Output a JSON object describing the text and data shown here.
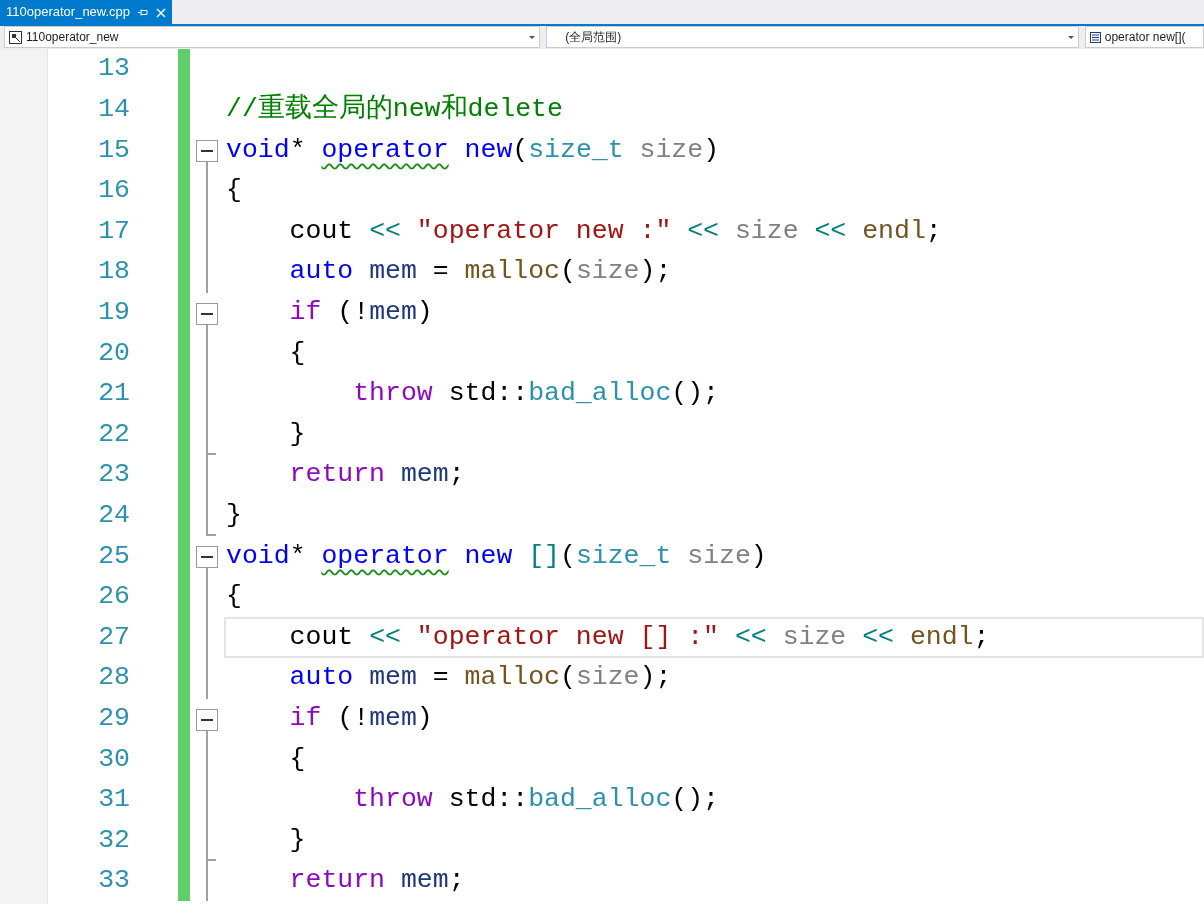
{
  "tabs": [
    {
      "label": "110operator_new.cpp",
      "selected": true,
      "pinned": false
    }
  ],
  "navbar": {
    "project": "110operator_new",
    "scope": "(全局范围)",
    "member": "operator new[]("
  },
  "lines": [
    {
      "number": "13",
      "changed": true,
      "current": false,
      "kind": "plain"
    },
    {
      "number": "14",
      "changed": true,
      "current": false,
      "kind": "plain",
      "tokens": [
        {
          "t": "//重载全局的new和delete",
          "kind": "comment"
        }
      ]
    },
    {
      "number": "15",
      "changed": true,
      "current": false,
      "kind": "fold-start",
      "expanded": true,
      "tokens": [
        {
          "t": "void",
          "kind": "keyword"
        },
        {
          "t": "* ",
          "kind": "plain"
        },
        {
          "t": "operator",
          "kind": "keyword",
          "squiggle": true
        },
        {
          "t": " new",
          "kind": "keyword"
        },
        {
          "t": "(",
          "kind": "plain"
        },
        {
          "t": "size_t",
          "kind": "type"
        },
        {
          "t": " size",
          "kind": "param"
        },
        {
          "t": ")",
          "kind": "plain"
        }
      ]
    },
    {
      "number": "16",
      "changed": true,
      "current": false,
      "kind": "fold-line",
      "tokens": [
        {
          "t": "{",
          "kind": "plain"
        }
      ]
    },
    {
      "number": "17",
      "changed": true,
      "current": false,
      "kind": "fold-line",
      "tokens": [
        {
          "t": "    cout ",
          "kind": "plain"
        },
        {
          "t": "<< ",
          "kind": "op"
        },
        {
          "t": "\"operator new :\"",
          "kind": "string"
        },
        {
          "t": " << ",
          "kind": "op"
        },
        {
          "t": "size",
          "kind": "param"
        },
        {
          "t": " << ",
          "kind": "op"
        },
        {
          "t": "endl",
          "kind": "func"
        },
        {
          "t": ";",
          "kind": "plain"
        }
      ]
    },
    {
      "number": "18",
      "changed": true,
      "current": false,
      "kind": "fold-line",
      "tokens": [
        {
          "t": "    auto",
          "kind": "keyword"
        },
        {
          "t": " mem",
          "kind": "local"
        },
        {
          "t": " = ",
          "kind": "plain"
        },
        {
          "t": "malloc",
          "kind": "func"
        },
        {
          "t": "(",
          "kind": "plain"
        },
        {
          "t": "size",
          "kind": "param"
        },
        {
          "t": ");",
          "kind": "plain"
        }
      ]
    },
    {
      "number": "19",
      "changed": true,
      "current": false,
      "kind": "fold-start",
      "expanded": true,
      "tokens": [
        {
          "t": "    if",
          "kind": "control"
        },
        {
          "t": " (!",
          "kind": "plain"
        },
        {
          "t": "mem",
          "kind": "local"
        },
        {
          "t": ")",
          "kind": "plain"
        }
      ]
    },
    {
      "number": "20",
      "changed": true,
      "current": false,
      "kind": "fold-line",
      "tokens": [
        {
          "t": "    {",
          "kind": "plain"
        }
      ]
    },
    {
      "number": "21",
      "changed": true,
      "current": false,
      "kind": "fold-line",
      "tokens": [
        {
          "t": "        throw",
          "kind": "control"
        },
        {
          "t": " std::",
          "kind": "plain"
        },
        {
          "t": "bad_alloc",
          "kind": "type"
        },
        {
          "t": "();",
          "kind": "plain"
        }
      ]
    },
    {
      "number": "22",
      "changed": true,
      "current": false,
      "kind": "fold-end",
      "tokens": [
        {
          "t": "    }",
          "kind": "plain"
        }
      ]
    },
    {
      "number": "23",
      "changed": true,
      "current": false,
      "kind": "fold-line",
      "tokens": [
        {
          "t": "    return",
          "kind": "control"
        },
        {
          "t": " mem",
          "kind": "local"
        },
        {
          "t": ";",
          "kind": "plain"
        }
      ]
    },
    {
      "number": "24",
      "changed": true,
      "current": false,
      "kind": "fold-end",
      "tokens": [
        {
          "t": "}",
          "kind": "plain"
        }
      ]
    },
    {
      "number": "25",
      "changed": true,
      "current": false,
      "kind": "fold-start",
      "expanded": true,
      "tokens": [
        {
          "t": "void",
          "kind": "keyword"
        },
        {
          "t": "* ",
          "kind": "plain"
        },
        {
          "t": "operator",
          "kind": "keyword",
          "squiggle": true
        },
        {
          "t": " new ",
          "kind": "keyword"
        },
        {
          "t": "[]",
          "kind": "op"
        },
        {
          "t": "(",
          "kind": "plain"
        },
        {
          "t": "size_t",
          "kind": "type"
        },
        {
          "t": " size",
          "kind": "param"
        },
        {
          "t": ")",
          "kind": "plain"
        }
      ]
    },
    {
      "number": "26",
      "changed": true,
      "current": false,
      "kind": "fold-line",
      "tokens": [
        {
          "t": "{",
          "kind": "plain"
        }
      ]
    },
    {
      "number": "27",
      "changed": true,
      "current": true,
      "kind": "fold-line",
      "tokens": [
        {
          "t": "    cout ",
          "kind": "plain"
        },
        {
          "t": "<< ",
          "kind": "op"
        },
        {
          "t": "\"operator new [] :\"",
          "kind": "string"
        },
        {
          "t": " << ",
          "kind": "op"
        },
        {
          "t": "size",
          "kind": "param"
        },
        {
          "t": " << ",
          "kind": "op"
        },
        {
          "t": "endl",
          "kind": "func"
        },
        {
          "t": ";",
          "kind": "plain"
        }
      ]
    },
    {
      "number": "28",
      "changed": true,
      "current": false,
      "kind": "fold-line",
      "tokens": [
        {
          "t": "    auto",
          "kind": "keyword"
        },
        {
          "t": " mem",
          "kind": "local"
        },
        {
          "t": " = ",
          "kind": "plain"
        },
        {
          "t": "malloc",
          "kind": "func"
        },
        {
          "t": "(",
          "kind": "plain"
        },
        {
          "t": "size",
          "kind": "param"
        },
        {
          "t": ");",
          "kind": "plain"
        }
      ]
    },
    {
      "number": "29",
      "changed": true,
      "current": false,
      "kind": "fold-start",
      "expanded": true,
      "tokens": [
        {
          "t": "    if",
          "kind": "control"
        },
        {
          "t": " (!",
          "kind": "plain"
        },
        {
          "t": "mem",
          "kind": "local"
        },
        {
          "t": ")",
          "kind": "plain"
        }
      ]
    },
    {
      "number": "30",
      "changed": true,
      "current": false,
      "kind": "fold-line",
      "tokens": [
        {
          "t": "    {",
          "kind": "plain"
        }
      ]
    },
    {
      "number": "31",
      "changed": true,
      "current": false,
      "kind": "fold-line",
      "tokens": [
        {
          "t": "        throw",
          "kind": "control"
        },
        {
          "t": " std::",
          "kind": "plain"
        },
        {
          "t": "bad_alloc",
          "kind": "type"
        },
        {
          "t": "();",
          "kind": "plain"
        }
      ]
    },
    {
      "number": "32",
      "changed": true,
      "current": false,
      "kind": "fold-end",
      "tokens": [
        {
          "t": "    }",
          "kind": "plain"
        }
      ]
    },
    {
      "number": "33",
      "changed": true,
      "current": false,
      "kind": "fold-line",
      "tokens": [
        {
          "t": "    return",
          "kind": "control"
        },
        {
          "t": " mem",
          "kind": "local"
        },
        {
          "t": ";",
          "kind": "plain"
        }
      ]
    }
  ]
}
